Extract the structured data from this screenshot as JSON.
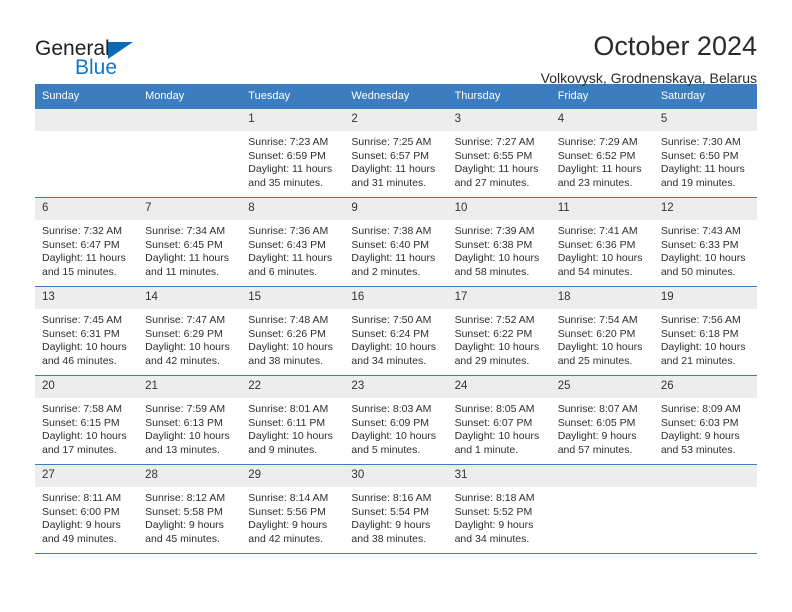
{
  "brand": {
    "name_top": "General",
    "name_bottom": "Blue",
    "accent_color": "#1277c4",
    "triangle_color": "#0d69b4"
  },
  "header": {
    "title": "October 2024",
    "subtitle": "Volkovysk, Grodnenskaya, Belarus"
  },
  "theme": {
    "header_row_bg": "#3b7dbf",
    "header_row_text": "#ffffff",
    "daynum_bg": "#ededed",
    "grid_line": "#3b7dbf"
  },
  "weekdays": [
    "Sunday",
    "Monday",
    "Tuesday",
    "Wednesday",
    "Thursday",
    "Friday",
    "Saturday"
  ],
  "weeks": [
    [
      {
        "day": "",
        "empty": true
      },
      {
        "day": "",
        "empty": true
      },
      {
        "day": "1",
        "sunrise": "Sunrise: 7:23 AM",
        "sunset": "Sunset: 6:59 PM",
        "daylight": "Daylight: 11 hours and 35 minutes."
      },
      {
        "day": "2",
        "sunrise": "Sunrise: 7:25 AM",
        "sunset": "Sunset: 6:57 PM",
        "daylight": "Daylight: 11 hours and 31 minutes."
      },
      {
        "day": "3",
        "sunrise": "Sunrise: 7:27 AM",
        "sunset": "Sunset: 6:55 PM",
        "daylight": "Daylight: 11 hours and 27 minutes."
      },
      {
        "day": "4",
        "sunrise": "Sunrise: 7:29 AM",
        "sunset": "Sunset: 6:52 PM",
        "daylight": "Daylight: 11 hours and 23 minutes."
      },
      {
        "day": "5",
        "sunrise": "Sunrise: 7:30 AM",
        "sunset": "Sunset: 6:50 PM",
        "daylight": "Daylight: 11 hours and 19 minutes."
      }
    ],
    [
      {
        "day": "6",
        "sunrise": "Sunrise: 7:32 AM",
        "sunset": "Sunset: 6:47 PM",
        "daylight": "Daylight: 11 hours and 15 minutes."
      },
      {
        "day": "7",
        "sunrise": "Sunrise: 7:34 AM",
        "sunset": "Sunset: 6:45 PM",
        "daylight": "Daylight: 11 hours and 11 minutes."
      },
      {
        "day": "8",
        "sunrise": "Sunrise: 7:36 AM",
        "sunset": "Sunset: 6:43 PM",
        "daylight": "Daylight: 11 hours and 6 minutes."
      },
      {
        "day": "9",
        "sunrise": "Sunrise: 7:38 AM",
        "sunset": "Sunset: 6:40 PM",
        "daylight": "Daylight: 11 hours and 2 minutes."
      },
      {
        "day": "10",
        "sunrise": "Sunrise: 7:39 AM",
        "sunset": "Sunset: 6:38 PM",
        "daylight": "Daylight: 10 hours and 58 minutes."
      },
      {
        "day": "11",
        "sunrise": "Sunrise: 7:41 AM",
        "sunset": "Sunset: 6:36 PM",
        "daylight": "Daylight: 10 hours and 54 minutes."
      },
      {
        "day": "12",
        "sunrise": "Sunrise: 7:43 AM",
        "sunset": "Sunset: 6:33 PM",
        "daylight": "Daylight: 10 hours and 50 minutes."
      }
    ],
    [
      {
        "day": "13",
        "sunrise": "Sunrise: 7:45 AM",
        "sunset": "Sunset: 6:31 PM",
        "daylight": "Daylight: 10 hours and 46 minutes."
      },
      {
        "day": "14",
        "sunrise": "Sunrise: 7:47 AM",
        "sunset": "Sunset: 6:29 PM",
        "daylight": "Daylight: 10 hours and 42 minutes."
      },
      {
        "day": "15",
        "sunrise": "Sunrise: 7:48 AM",
        "sunset": "Sunset: 6:26 PM",
        "daylight": "Daylight: 10 hours and 38 minutes."
      },
      {
        "day": "16",
        "sunrise": "Sunrise: 7:50 AM",
        "sunset": "Sunset: 6:24 PM",
        "daylight": "Daylight: 10 hours and 34 minutes."
      },
      {
        "day": "17",
        "sunrise": "Sunrise: 7:52 AM",
        "sunset": "Sunset: 6:22 PM",
        "daylight": "Daylight: 10 hours and 29 minutes."
      },
      {
        "day": "18",
        "sunrise": "Sunrise: 7:54 AM",
        "sunset": "Sunset: 6:20 PM",
        "daylight": "Daylight: 10 hours and 25 minutes."
      },
      {
        "day": "19",
        "sunrise": "Sunrise: 7:56 AM",
        "sunset": "Sunset: 6:18 PM",
        "daylight": "Daylight: 10 hours and 21 minutes."
      }
    ],
    [
      {
        "day": "20",
        "sunrise": "Sunrise: 7:58 AM",
        "sunset": "Sunset: 6:15 PM",
        "daylight": "Daylight: 10 hours and 17 minutes."
      },
      {
        "day": "21",
        "sunrise": "Sunrise: 7:59 AM",
        "sunset": "Sunset: 6:13 PM",
        "daylight": "Daylight: 10 hours and 13 minutes."
      },
      {
        "day": "22",
        "sunrise": "Sunrise: 8:01 AM",
        "sunset": "Sunset: 6:11 PM",
        "daylight": "Daylight: 10 hours and 9 minutes."
      },
      {
        "day": "23",
        "sunrise": "Sunrise: 8:03 AM",
        "sunset": "Sunset: 6:09 PM",
        "daylight": "Daylight: 10 hours and 5 minutes."
      },
      {
        "day": "24",
        "sunrise": "Sunrise: 8:05 AM",
        "sunset": "Sunset: 6:07 PM",
        "daylight": "Daylight: 10 hours and 1 minute."
      },
      {
        "day": "25",
        "sunrise": "Sunrise: 8:07 AM",
        "sunset": "Sunset: 6:05 PM",
        "daylight": "Daylight: 9 hours and 57 minutes."
      },
      {
        "day": "26",
        "sunrise": "Sunrise: 8:09 AM",
        "sunset": "Sunset: 6:03 PM",
        "daylight": "Daylight: 9 hours and 53 minutes."
      }
    ],
    [
      {
        "day": "27",
        "sunrise": "Sunrise: 8:11 AM",
        "sunset": "Sunset: 6:00 PM",
        "daylight": "Daylight: 9 hours and 49 minutes."
      },
      {
        "day": "28",
        "sunrise": "Sunrise: 8:12 AM",
        "sunset": "Sunset: 5:58 PM",
        "daylight": "Daylight: 9 hours and 45 minutes."
      },
      {
        "day": "29",
        "sunrise": "Sunrise: 8:14 AM",
        "sunset": "Sunset: 5:56 PM",
        "daylight": "Daylight: 9 hours and 42 minutes."
      },
      {
        "day": "30",
        "sunrise": "Sunrise: 8:16 AM",
        "sunset": "Sunset: 5:54 PM",
        "daylight": "Daylight: 9 hours and 38 minutes."
      },
      {
        "day": "31",
        "sunrise": "Sunrise: 8:18 AM",
        "sunset": "Sunset: 5:52 PM",
        "daylight": "Daylight: 9 hours and 34 minutes."
      },
      {
        "day": "",
        "empty": true
      },
      {
        "day": "",
        "empty": true
      }
    ]
  ]
}
